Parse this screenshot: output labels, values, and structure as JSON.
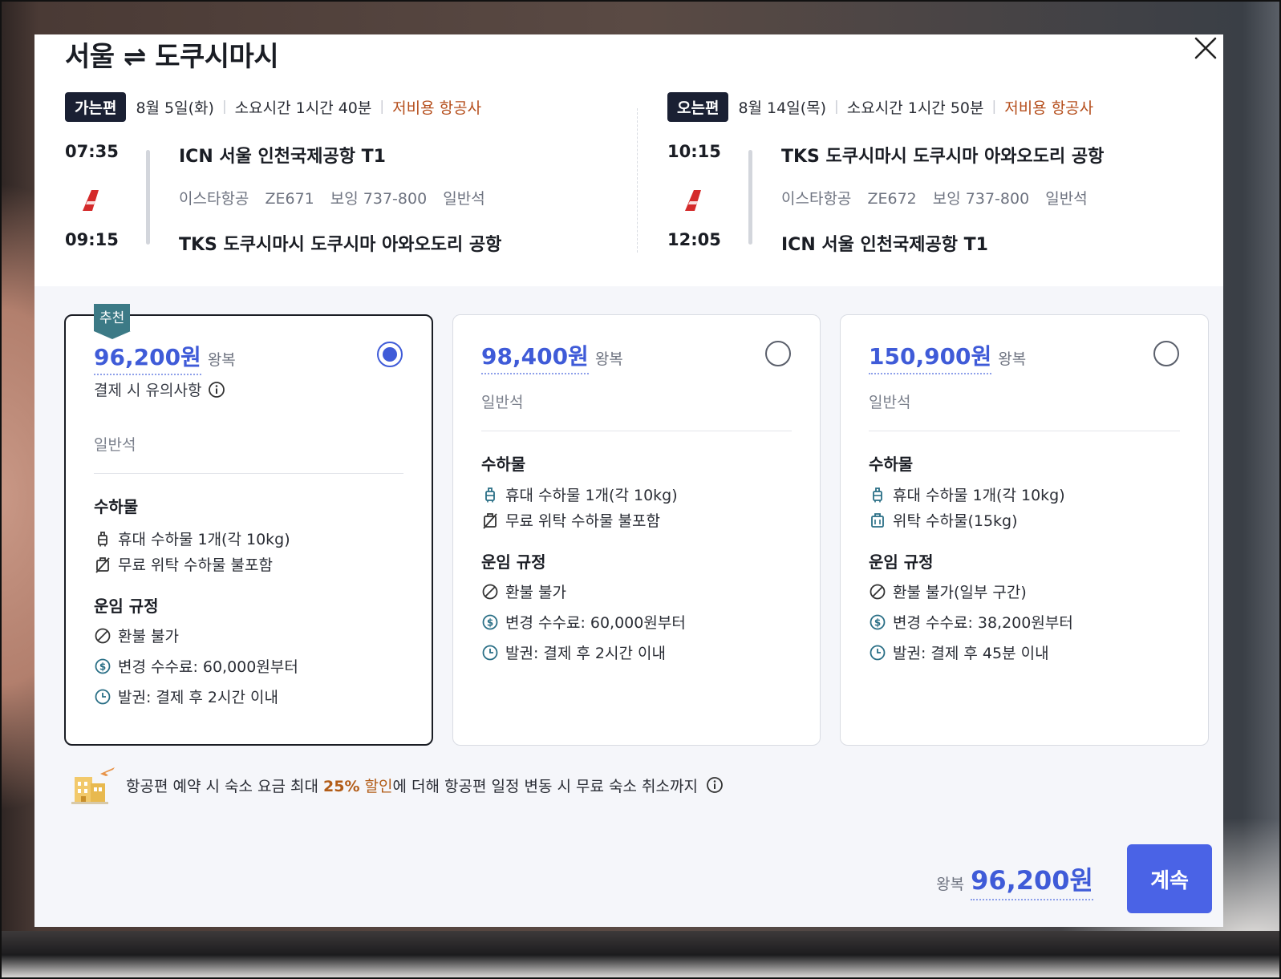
{
  "header": {
    "route": "서울 ⇌ 도쿠시마시"
  },
  "outbound": {
    "tag": "가는편",
    "date": "8월 5일(화)",
    "duration": "소요시간 1시간 40분",
    "lowcost": "저비용 항공사",
    "dep_time": "07:35",
    "arr_time": "09:15",
    "dep_airport": "ICN 서울 인천국제공항 T1",
    "arr_airport": "TKS 도쿠시마시 도쿠시마 아와오도리 공항",
    "airline": "이스타항공",
    "flight_no": "ZE671",
    "aircraft": "보잉 737-800",
    "cabin": "일반석"
  },
  "return": {
    "tag": "오는편",
    "date": "8월 14일(목)",
    "duration": "소요시간 1시간 50분",
    "lowcost": "저비용 항공사",
    "dep_time": "10:15",
    "arr_time": "12:05",
    "dep_airport": "TKS 도쿠시마시 도쿠시마 아와오도리 공항",
    "arr_airport": "ICN 서울 인천국제공항 T1",
    "airline": "이스타항공",
    "flight_no": "ZE672",
    "aircraft": "보잉 737-800",
    "cabin": "일반석"
  },
  "fares": [
    {
      "badge": "추천",
      "price": "96,200원",
      "trip": "왕복",
      "notice": "결제 시 유의사항",
      "cabin": "일반석",
      "baggage_title": "수하물",
      "carry_on": "휴대 수하물 1개(각 10kg)",
      "checked": "무료 위탁 수하물 불포함",
      "rules_title": "운임 규정",
      "refund": "환불 불가",
      "change_fee": "변경 수수료: 60,000원부터",
      "ticketing": "발권: 결제 후 2시간 이내",
      "selected": true
    },
    {
      "price": "98,400원",
      "trip": "왕복",
      "cabin": "일반석",
      "baggage_title": "수하물",
      "carry_on": "휴대 수하물 1개(각 10kg)",
      "checked": "무료 위탁 수하물 불포함",
      "rules_title": "운임 규정",
      "refund": "환불 불가",
      "change_fee": "변경 수수료: 60,000원부터",
      "ticketing": "발권: 결제 후 2시간 이내",
      "selected": false
    },
    {
      "price": "150,900원",
      "trip": "왕복",
      "cabin": "일반석",
      "baggage_title": "수하물",
      "carry_on": "휴대 수하물 1개(각 10kg)",
      "checked": "위탁 수하물(15kg)",
      "rules_title": "운임 규정",
      "refund": "환불 불가(일부 구간)",
      "change_fee": "변경 수수료: 38,200원부터",
      "ticketing": "발권: 결제 후 45분 이내",
      "selected": false
    }
  ],
  "promo": {
    "pre": "항공편 예약 시 숙소 요금 최대 ",
    "pct": "25%",
    "disc": " 할인",
    "post": "에 더해 항공편 일정 변동 시 무료 숙소 취소까지"
  },
  "footer": {
    "total_label": "왕복",
    "total_price": "96,200원",
    "continue_label": "계속"
  },
  "colors": {
    "accent": "#3f5bd8",
    "button": "#4a63e6",
    "tag_bg": "#1a2033",
    "lowcost": "#b54e1c",
    "recommend": "#3c7a86"
  }
}
